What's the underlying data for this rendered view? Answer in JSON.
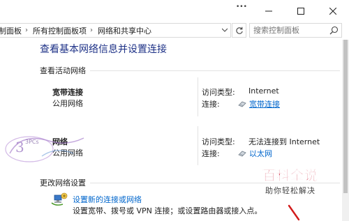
{
  "titlebar": {
    "dots": "•••",
    "minimize_icon": "minimize-icon",
    "maximize_icon": "maximize-icon",
    "close_icon": "close-icon"
  },
  "address": {
    "breadcrumbs": [
      "制面板",
      "所有控制面板项",
      "网络和共享中心"
    ],
    "search_placeholder": "搜索控制面板"
  },
  "page": {
    "title": "查看基本网络信息并设置连接",
    "active_networks_heading": "查看活动网络",
    "change_settings_heading": "更改网络设置"
  },
  "networks": [
    {
      "name": "宽带连接",
      "category": "公用网络",
      "access_type_label": "访问类型:",
      "access_type_value": "Internet",
      "connection_label": "连接:",
      "connection_value": "宽带连接"
    },
    {
      "name": "网络",
      "category": "公用网络",
      "access_type_label": "访问类型:",
      "access_type_value": "无法连接到 Internet",
      "connection_label": "连接:",
      "connection_value": "以太网"
    }
  ],
  "tasks": [
    {
      "link": "设置新的连接或网络",
      "description": "设置宽带、拨号或 VPN 连接；或设置路由器或接入点。"
    }
  ],
  "watermark": {
    "brand_main": "百科全说",
    "brand_sub": "助你轻松解决",
    "logo_text": "3PCs"
  },
  "colors": {
    "title_blue": "#1e3287",
    "link_blue": "#0066cc",
    "brand_red": "#c8102e"
  }
}
